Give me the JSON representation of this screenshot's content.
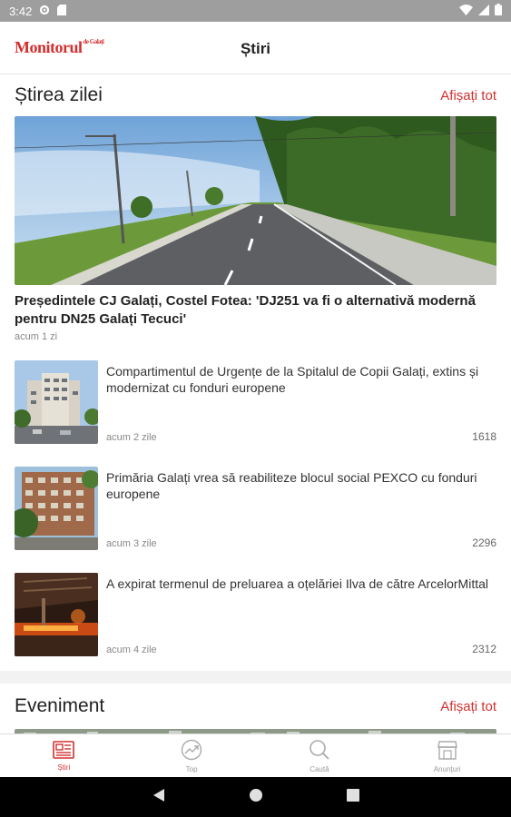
{
  "status_bar": {
    "time": "3:42"
  },
  "app_bar": {
    "logo_text": "Monitorul",
    "logo_small": "de Galați",
    "title": "Știri"
  },
  "sections": [
    {
      "title": "Știrea zilei",
      "show_all": "Afișați tot",
      "hero": {
        "title": "Președintele CJ Galați, Costel Fotea: 'DJ251 va fi o alternativă modernă pentru DN25 Galați Tecuci'",
        "time": "acum 1 zi"
      },
      "items": [
        {
          "title": "Compartimentul de Urgențe de la Spitalul de Copii Galați, extins și modernizat cu fonduri europene",
          "time": "acum 2 zile",
          "views": "1618"
        },
        {
          "title": "Primăria Galați vrea să reabiliteze blocul social PEXCO cu fonduri europene",
          "time": "acum 3 zile",
          "views": "2296"
        },
        {
          "title": "A expirat termenul de preluarea a oțelăriei Ilva de către ArcelorMittal",
          "time": "acum 4 zile",
          "views": "2312"
        }
      ]
    },
    {
      "title": "Eveniment",
      "show_all": "Afișați tot"
    }
  ],
  "bottom_nav": [
    {
      "label": "Știri",
      "icon": "news-icon",
      "active": true
    },
    {
      "label": "Top",
      "icon": "trending-icon",
      "active": false
    },
    {
      "label": "Caută",
      "icon": "search-icon",
      "active": false
    },
    {
      "label": "Anunțuri",
      "icon": "store-icon",
      "active": false
    }
  ],
  "colors": {
    "accent": "#d32f2f",
    "status_bar": "#9e9e9e"
  }
}
